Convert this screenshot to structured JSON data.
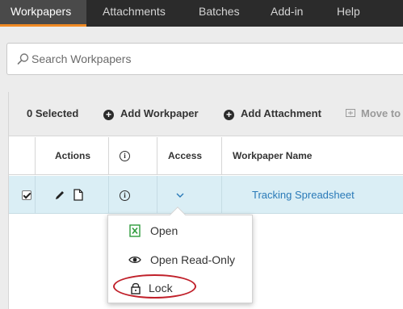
{
  "nav": {
    "tabs": [
      {
        "label": "Workpapers",
        "active": true
      },
      {
        "label": "Attachments",
        "active": false
      },
      {
        "label": "Batches",
        "active": false
      },
      {
        "label": "Add-in",
        "active": false
      },
      {
        "label": "Help",
        "active": false
      }
    ]
  },
  "search": {
    "placeholder": "Search Workpapers",
    "value": ""
  },
  "toolbar": {
    "selected_label": "0 Selected",
    "add_workpaper_label": "Add Workpaper",
    "add_attachment_label": "Add Attachment",
    "move_to_label": "Move to"
  },
  "table": {
    "headers": {
      "actions": "Actions",
      "info": "i",
      "access": "Access",
      "name": "Workpaper Name"
    },
    "rows": [
      {
        "selected": true,
        "name": "Tracking Spreadsheet"
      }
    ]
  },
  "access_menu": {
    "items": [
      {
        "label": "Open",
        "icon": "excel-icon"
      },
      {
        "label": "Open Read-Only",
        "icon": "eye-icon"
      },
      {
        "label": "Lock",
        "icon": "lock-icon"
      }
    ]
  },
  "colors": {
    "nav_bg": "#2b2b2b",
    "active_tab_accent": "#f08a24",
    "row_selected_bg": "#daeef5",
    "link": "#2a7ab8",
    "highlight_ring": "#c0202a",
    "excel_green": "#2e9b3c"
  }
}
